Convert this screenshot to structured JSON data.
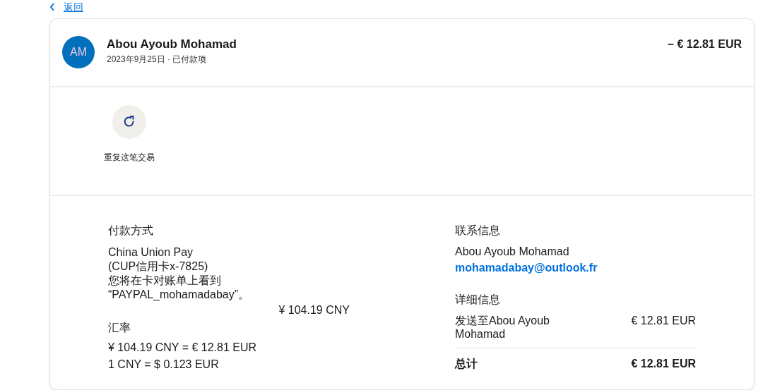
{
  "back_link": {
    "label": "返回"
  },
  "header": {
    "avatar_initials": "AM",
    "name": "Abou Ayoub Mohamad",
    "date": "2023年9月25日",
    "separator": "·",
    "status": "已付款项",
    "amount": "− € 12.81 EUR"
  },
  "actions": [
    {
      "label": "重复这笔交易"
    }
  ],
  "payment_method": {
    "heading": "付款方式",
    "lines": [
      "China Union Pay",
      "(CUP信用卡x-7825)",
      "您将在卡对账单上看到",
      "“PAYPAL_mohamadabay”。"
    ],
    "amount": "¥ 104.19 CNY"
  },
  "exchange_rate": {
    "heading": "汇率",
    "lines": [
      "¥ 104.19 CNY = € 12.81 EUR",
      "1 CNY = $ 0.123 EUR"
    ]
  },
  "contact": {
    "heading": "联系信息",
    "name": "Abou Ayoub Mohamad",
    "email": "mohamadabay@outlook.fr"
  },
  "details": {
    "heading": "详细信息",
    "rows": [
      {
        "kind": "item",
        "label": "发送至Abou Ayoub Mohamad",
        "value": "€ 12.81 EUR"
      },
      {
        "kind": "total",
        "label": "总计",
        "value": "€ 12.81 EUR"
      }
    ]
  }
}
